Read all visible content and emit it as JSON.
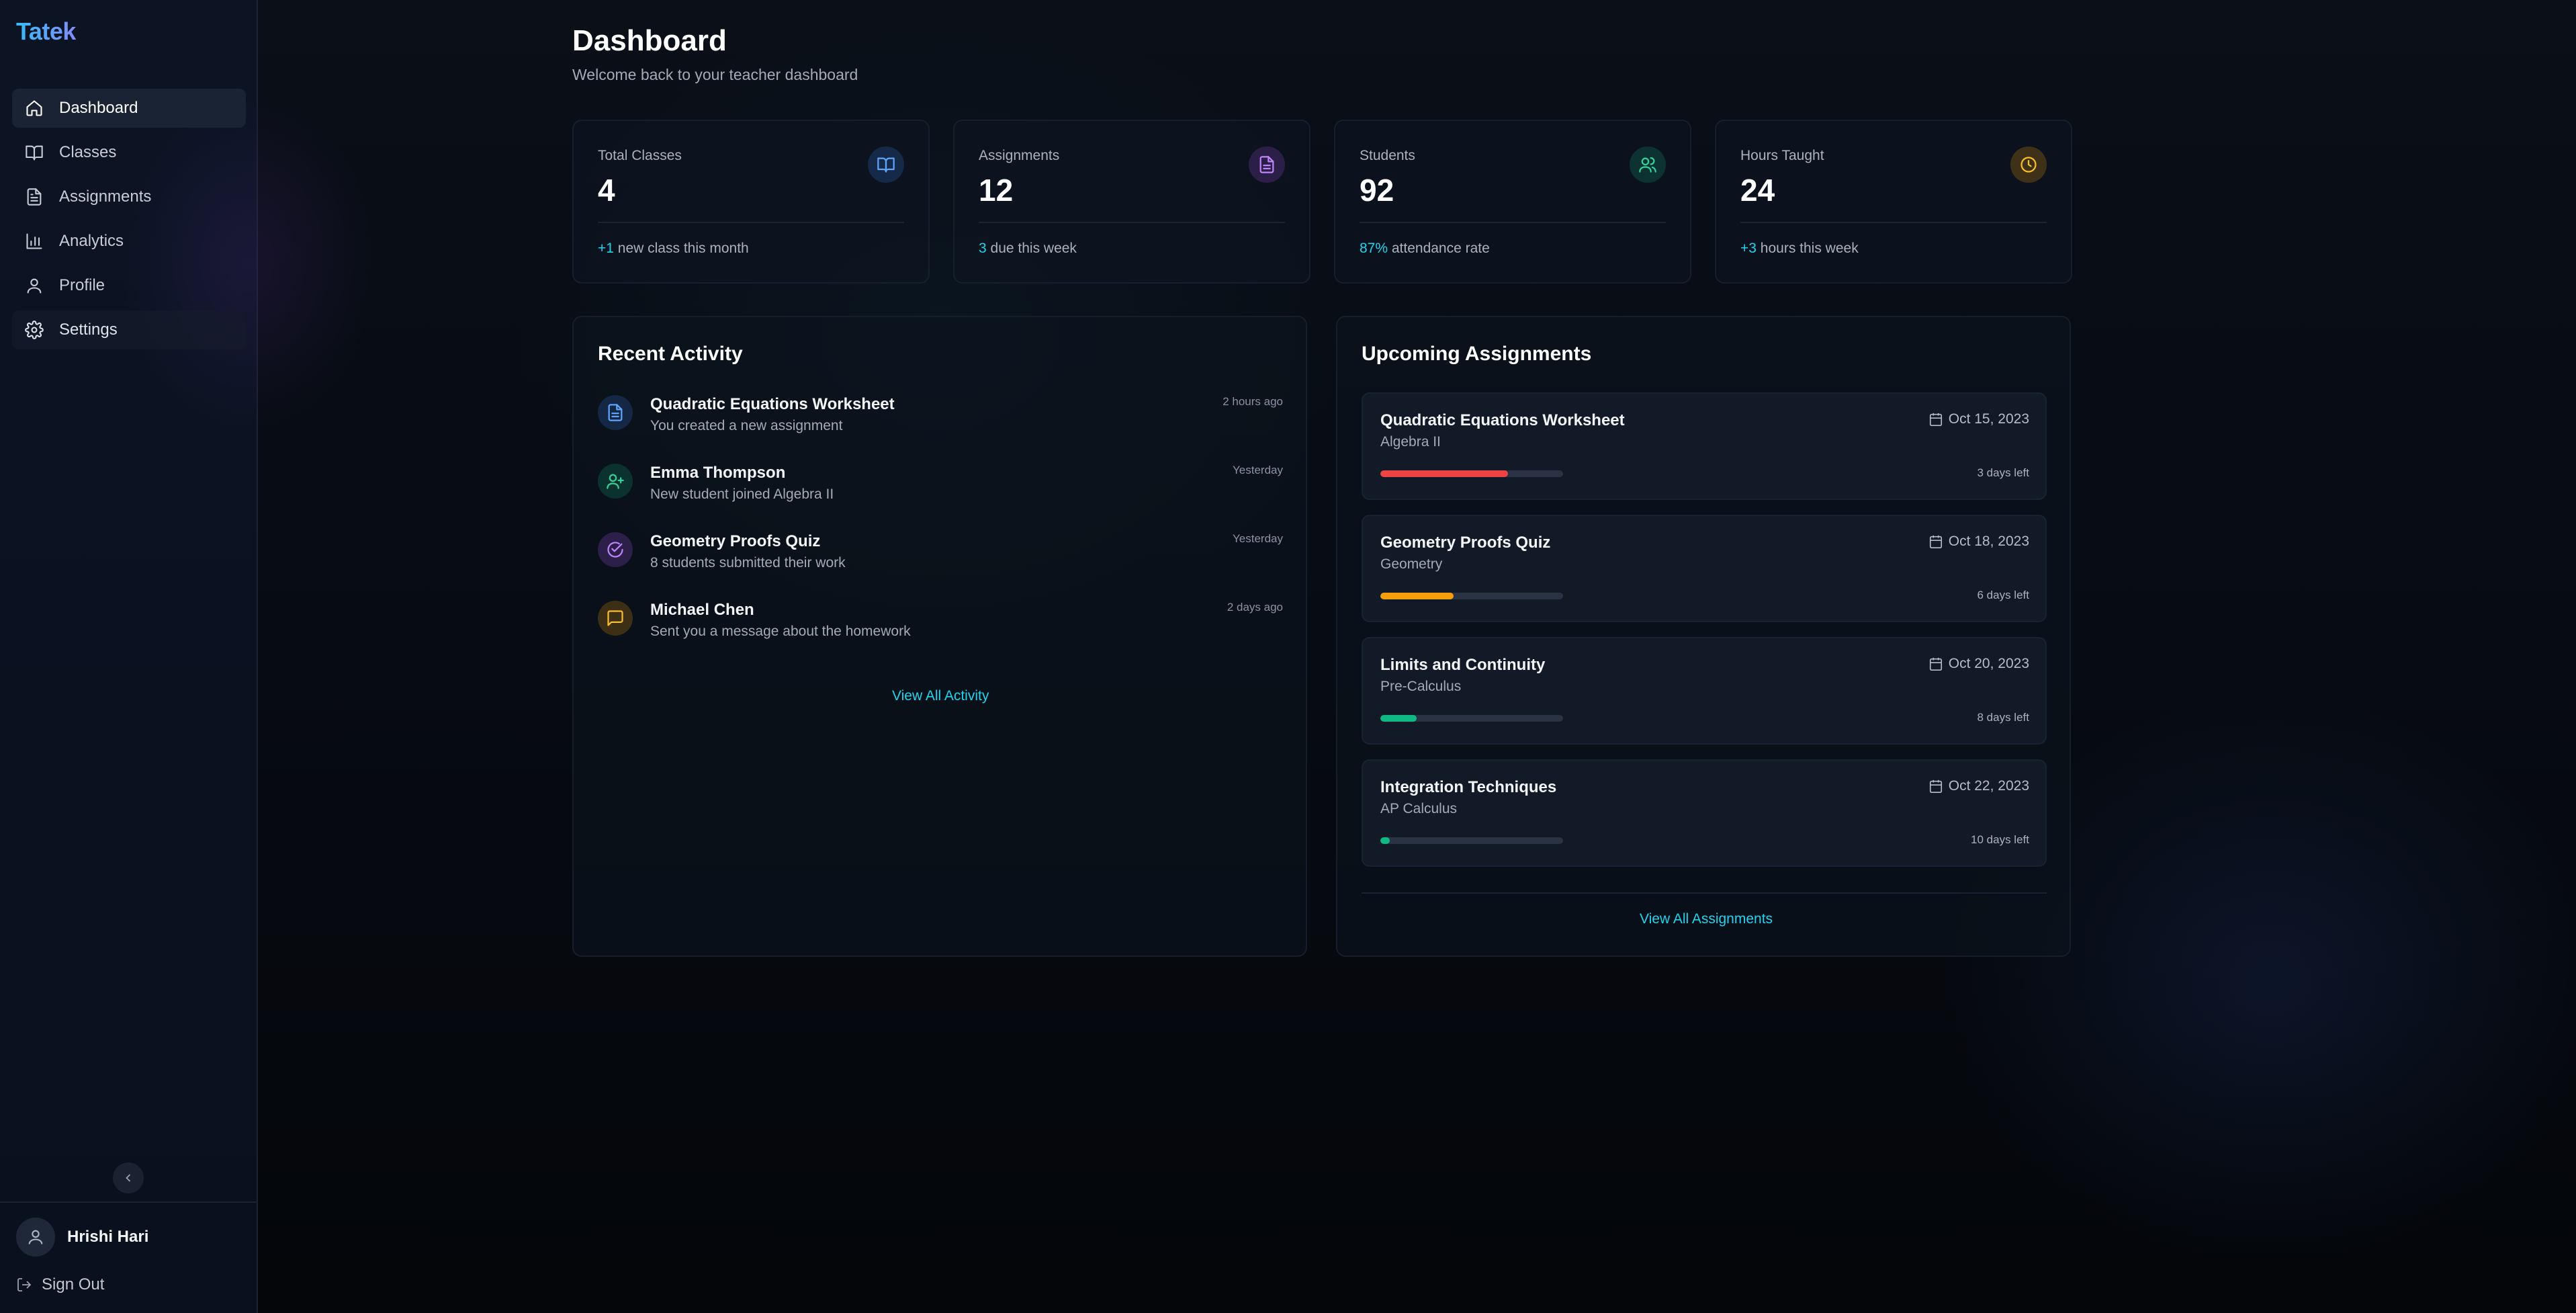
{
  "app": {
    "brand": "Tatek"
  },
  "sidebar": {
    "items": [
      {
        "label": "Dashboard",
        "icon": "home-icon",
        "active": true
      },
      {
        "label": "Classes",
        "icon": "book-icon"
      },
      {
        "label": "Assignments",
        "icon": "file-text-icon"
      },
      {
        "label": "Analytics",
        "icon": "bar-chart-icon"
      },
      {
        "label": "Profile",
        "icon": "user-icon"
      },
      {
        "label": "Settings",
        "icon": "gear-icon"
      }
    ],
    "user_name": "Hrishi Hari",
    "sign_out": "Sign Out"
  },
  "header": {
    "title": "Dashboard",
    "subtitle": "Welcome back to your teacher dashboard"
  },
  "stats": [
    {
      "label": "Total Classes",
      "value": "4",
      "highlight": "+1",
      "footer": " new class this month",
      "icon": "book-open-icon",
      "color": "#60a5fa"
    },
    {
      "label": "Assignments",
      "value": "12",
      "highlight": "3",
      "footer": " due this week",
      "icon": "file-text-icon",
      "color": "#c084fc"
    },
    {
      "label": "Students",
      "value": "92",
      "highlight": "87%",
      "footer": " attendance rate",
      "icon": "users-icon",
      "color": "#34d399"
    },
    {
      "label": "Hours Taught",
      "value": "24",
      "highlight": "+3",
      "footer": " hours this week",
      "icon": "clock-icon",
      "color": "#fbbf24"
    }
  ],
  "recent_activity": {
    "title": "Recent Activity",
    "items": [
      {
        "title": "Quadratic Equations Worksheet",
        "desc": "You created a new assignment",
        "time": "2 hours ago",
        "icon": "file-text-icon",
        "color": "#60a5fa"
      },
      {
        "title": "Emma Thompson",
        "desc": "New student joined Algebra II",
        "time": "Yesterday",
        "icon": "user-plus-icon",
        "color": "#34d399"
      },
      {
        "title": "Geometry Proofs Quiz",
        "desc": "8 students submitted their work",
        "time": "Yesterday",
        "icon": "check-circle-icon",
        "color": "#c084fc"
      },
      {
        "title": "Michael Chen",
        "desc": "Sent you a message about the homework",
        "time": "2 days ago",
        "icon": "message-icon",
        "color": "#fbbf24"
      }
    ],
    "view_all": "View All Activity"
  },
  "upcoming": {
    "title": "Upcoming Assignments",
    "items": [
      {
        "title": "Quadratic Equations Worksheet",
        "course": "Algebra II",
        "date": "Oct 15, 2023",
        "left": "3 days left",
        "progress": 0.7,
        "color": "#ef4444"
      },
      {
        "title": "Geometry Proofs Quiz",
        "course": "Geometry",
        "date": "Oct 18, 2023",
        "left": "6 days left",
        "progress": 0.4,
        "color": "#f59e0b"
      },
      {
        "title": "Limits and Continuity",
        "course": "Pre-Calculus",
        "date": "Oct 20, 2023",
        "left": "8 days left",
        "progress": 0.2,
        "color": "#10b981"
      },
      {
        "title": "Integration Techniques",
        "course": "AP Calculus",
        "date": "Oct 22, 2023",
        "left": "10 days left",
        "progress": 0.05,
        "color": "#10b981"
      }
    ],
    "view_all": "View All Assignments"
  }
}
